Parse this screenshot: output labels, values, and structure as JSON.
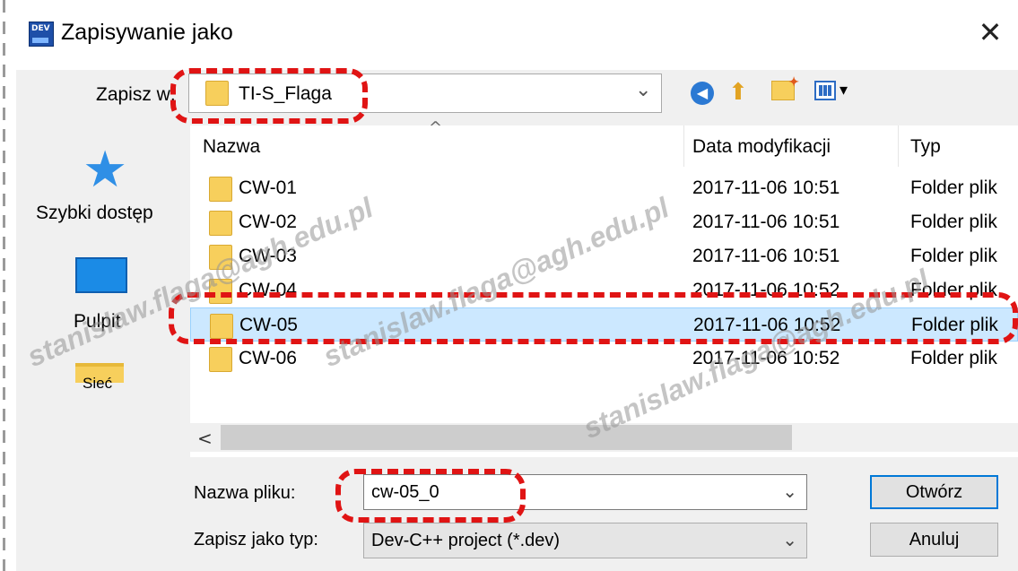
{
  "window": {
    "app_icon_text": "DEV",
    "title": "Zapisywanie jako",
    "close_glyph": "✕"
  },
  "location": {
    "label": "Zapisz w:",
    "value": "TI-S_Flaga"
  },
  "places": [
    {
      "label": "Szybki dostęp",
      "icon": "quick-access-star-icon"
    },
    {
      "label": "Pulpit",
      "icon": "desktop-icon"
    },
    {
      "label": "Sieć",
      "icon": "network-icon"
    }
  ],
  "list": {
    "columns": [
      "Nazwa",
      "Data modyfikacji",
      "Typ"
    ],
    "rows": [
      {
        "name": "CW-01",
        "date": "2017-11-06 10:51",
        "type": "Folder plik"
      },
      {
        "name": "CW-02",
        "date": "2017-11-06 10:51",
        "type": "Folder plik"
      },
      {
        "name": "CW-03",
        "date": "2017-11-06 10:51",
        "type": "Folder plik"
      },
      {
        "name": "CW-04",
        "date": "2017-11-06 10:52",
        "type": "Folder plik"
      },
      {
        "name": "CW-05",
        "date": "2017-11-06 10:52",
        "type": "Folder plik"
      },
      {
        "name": "CW-06",
        "date": "2017-11-06 10:52",
        "type": "Folder plik"
      }
    ],
    "selected_index": 4
  },
  "filename": {
    "label": "Nazwa pliku:",
    "value": "cw-05_0"
  },
  "filetype": {
    "label": "Zapisz jako typ:",
    "value": "Dev-C++ project (*.dev)"
  },
  "buttons": {
    "open": "Otwórz",
    "cancel": "Anuluj"
  },
  "watermark": "stanislaw.flaga@agh.edu.pl",
  "colors": {
    "callout": "#e01414",
    "selection": "#cce8ff",
    "accent": "#0078d7"
  }
}
